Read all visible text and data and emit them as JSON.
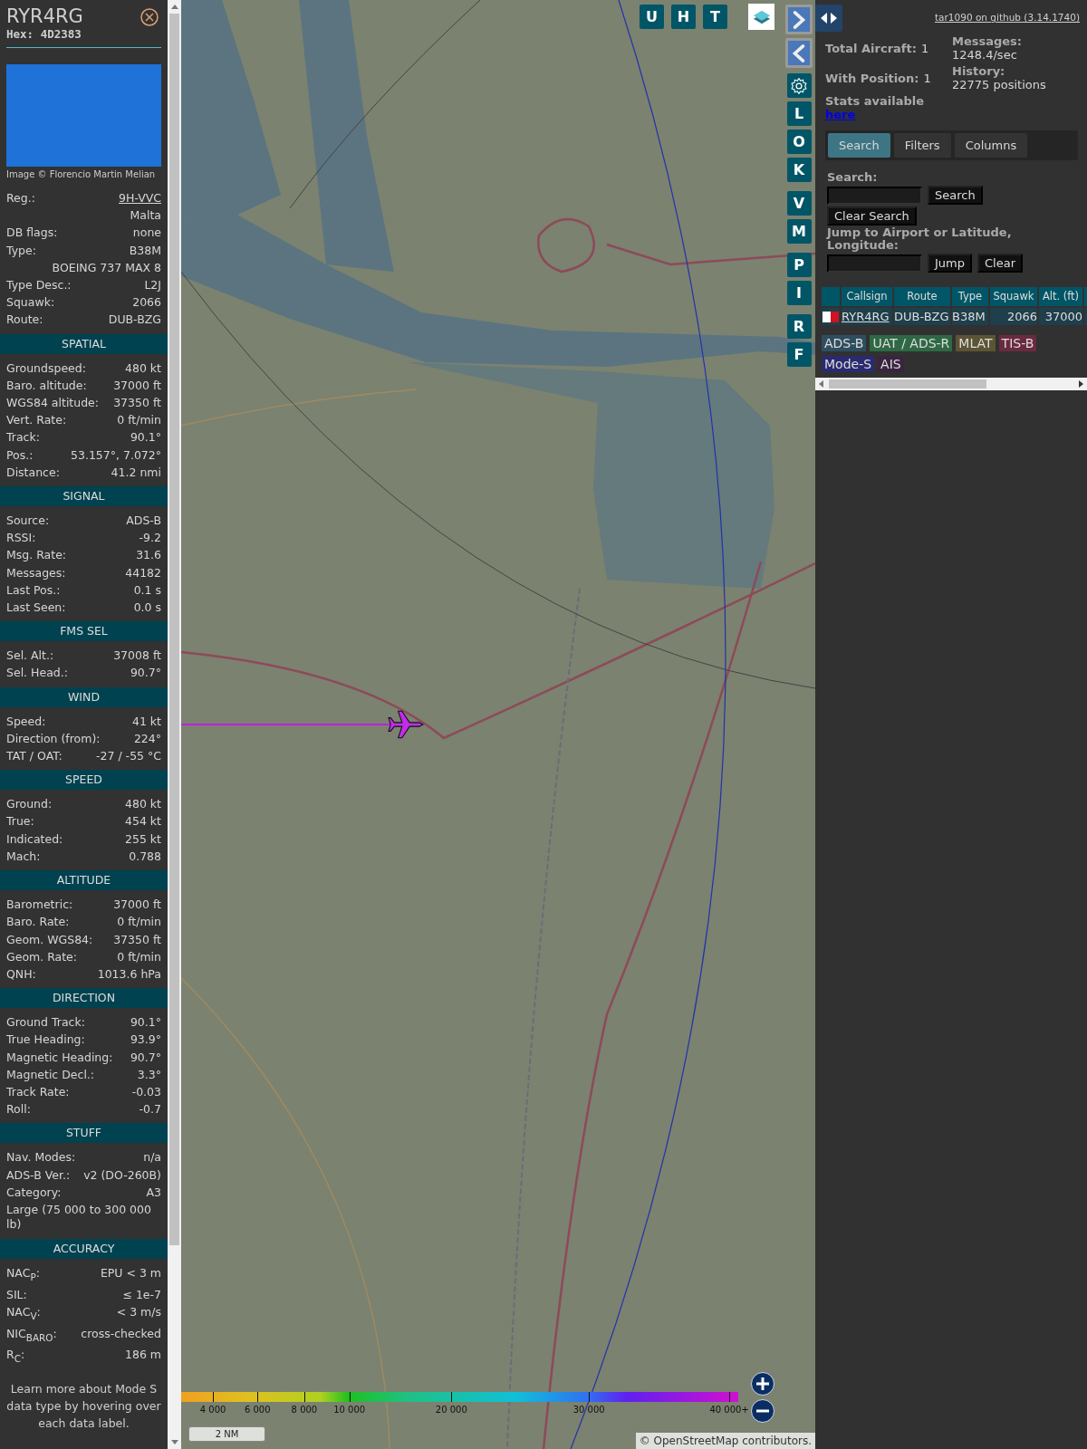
{
  "aircraft": {
    "callsign": "RYR4RG",
    "hex": "Hex: 4D2383",
    "photo_credit": "Image © Florencio Martin Melian",
    "details": [
      {
        "kind": "link",
        "label": "Reg.:",
        "value": "9H-VVC"
      },
      {
        "kind": "value",
        "value": "Malta"
      },
      {
        "kind": "pair",
        "label": "DB flags:",
        "value": "none"
      },
      {
        "kind": "pair",
        "label": "Type:",
        "value": "B38M"
      },
      {
        "kind": "value",
        "value": "BOEING 737 MAX 8"
      },
      {
        "kind": "pair",
        "label": "Type Desc.:",
        "value": "L2J"
      },
      {
        "kind": "pair",
        "label": "Squawk:",
        "value": "2066"
      },
      {
        "kind": "pair",
        "label": "Route:",
        "value": "DUB-BZG"
      }
    ]
  },
  "sections": [
    {
      "title": "SPATIAL",
      "rows": [
        {
          "kind": "pair",
          "label": "Groundspeed:",
          "value": "480 kt"
        },
        {
          "kind": "pair",
          "label": "Baro. altitude:",
          "value": "37000 ft"
        },
        {
          "kind": "pair",
          "label": "WGS84 altitude:",
          "value": "37350 ft"
        },
        {
          "kind": "pair",
          "label": "Vert. Rate:",
          "value": "0 ft/min"
        },
        {
          "kind": "pair",
          "label": "Track:",
          "value": "90.1°"
        },
        {
          "kind": "pair",
          "label": "Pos.:",
          "value": "53.157°, 7.072°"
        },
        {
          "kind": "pair",
          "label": "Distance:",
          "value": "41.2 nmi"
        }
      ]
    },
    {
      "title": "SIGNAL",
      "rows": [
        {
          "kind": "pair",
          "label": "Source:",
          "value": "ADS-B"
        },
        {
          "kind": "pair",
          "label": "RSSI:",
          "value": "-9.2"
        },
        {
          "kind": "pair",
          "label": "Msg. Rate:",
          "value": "31.6"
        },
        {
          "kind": "pair",
          "label": "Messages:",
          "value": "44182"
        },
        {
          "kind": "pair",
          "label": "Last Pos.:",
          "value": "0.1 s"
        },
        {
          "kind": "pair",
          "label": "Last Seen:",
          "value": "0.0 s"
        }
      ]
    },
    {
      "title": "FMS SEL",
      "rows": [
        {
          "kind": "pair",
          "label": "Sel. Alt.:",
          "value": "37008 ft"
        },
        {
          "kind": "pair",
          "label": "Sel. Head.:",
          "value": "90.7°"
        }
      ]
    },
    {
      "title": "WIND",
      "rows": [
        {
          "kind": "pair",
          "label": "Speed:",
          "value": "41 kt"
        },
        {
          "kind": "pair",
          "label": "Direction (from):",
          "value": "224°"
        },
        {
          "kind": "pair",
          "label": "TAT / OAT:",
          "value": "-27 / -55 °C"
        }
      ]
    },
    {
      "title": "SPEED",
      "rows": [
        {
          "kind": "pair",
          "label": "Ground:",
          "value": "480 kt"
        },
        {
          "kind": "pair",
          "label": "True:",
          "value": "454 kt"
        },
        {
          "kind": "pair",
          "label": "Indicated:",
          "value": "255 kt"
        },
        {
          "kind": "pair",
          "label": "Mach:",
          "value": "0.788"
        }
      ]
    },
    {
      "title": "ALTITUDE",
      "rows": [
        {
          "kind": "pair",
          "label": "Barometric:",
          "value": "37000 ft"
        },
        {
          "kind": "pair",
          "label": "Baro. Rate:",
          "value": "0 ft/min"
        },
        {
          "kind": "pair",
          "label": "Geom. WGS84:",
          "value": "37350 ft"
        },
        {
          "kind": "pair",
          "label": "Geom. Rate:",
          "value": "0 ft/min"
        },
        {
          "kind": "pair",
          "label": "QNH:",
          "value": "1013.6 hPa"
        }
      ]
    },
    {
      "title": "DIRECTION",
      "rows": [
        {
          "kind": "pair",
          "label": "Ground Track:",
          "value": "90.1°"
        },
        {
          "kind": "pair",
          "label": "True Heading:",
          "value": "93.9°"
        },
        {
          "kind": "pair",
          "label": "Magnetic Heading:",
          "value": "90.7°"
        },
        {
          "kind": "pair",
          "label": "Magnetic Decl.:",
          "value": "3.3°"
        },
        {
          "kind": "pair",
          "label": "Track Rate:",
          "value": "-0.03"
        },
        {
          "kind": "pair",
          "label": "Roll:",
          "value": "-0.7"
        }
      ]
    },
    {
      "title": "STUFF",
      "rows": [
        {
          "kind": "pair",
          "label": "Nav. Modes:",
          "value": "n/a"
        },
        {
          "kind": "pair",
          "label": "ADS-B Ver.:",
          "value": "v2 (DO-260B)"
        },
        {
          "kind": "pair",
          "label": "Category:",
          "value": "A3"
        },
        {
          "kind": "note",
          "value": "Large (75 000 to 300 000 lb)"
        }
      ]
    },
    {
      "title": "ACCURACY",
      "rows": [
        {
          "kind": "pair",
          "label": "NAC$_{P}$:",
          "value": "EPU < 3 m"
        },
        {
          "kind": "pair",
          "label": "SIL:",
          "value": "≤ 1e-7"
        },
        {
          "kind": "pair",
          "label": "NAC$_{V}$:",
          "value": "< 3 m/s"
        },
        {
          "kind": "pair",
          "label": "NIC$_{BARO}$:",
          "value": "cross-checked"
        },
        {
          "kind": "pair",
          "label": "R$_{C}$:",
          "value": "186 m"
        }
      ]
    }
  ],
  "footer_note": "Learn more about Mode S data type by hovering over each data label.",
  "map": {
    "top_buttons": [
      "U",
      "H",
      "T"
    ],
    "side_button_groups": [
      [
        "L",
        "O",
        "K"
      ],
      [
        "V",
        "M"
      ],
      [
        "P",
        "I"
      ],
      [
        "R",
        "F"
      ]
    ],
    "legend_labels": [
      "4 000",
      "6 000",
      "8 000",
      "10 000",
      "20 000",
      "30 000",
      "40 000+"
    ],
    "scale": "2 NM",
    "attribution": {
      "prefix": "©",
      "link": "OpenStreetMap",
      "suffix": "contributors."
    }
  },
  "header_link": "tar1090 on github (3.14.1740)",
  "stats_columns": [
    [
      {
        "label": "Total Aircraft:",
        "value": "1"
      },
      {
        "label": "With Position:",
        "value": "1"
      }
    ],
    [
      {
        "label": "Messages:",
        "value": "1248.4/sec"
      },
      {
        "label": "History:",
        "value": "22775 positions"
      }
    ]
  ],
  "stats_link": {
    "text": "Stats available",
    "link": "here"
  },
  "tabs": [
    {
      "label": "Search",
      "selected": true
    },
    {
      "label": "Filters",
      "selected": false
    },
    {
      "label": "Columns",
      "selected": false
    }
  ],
  "search": {
    "label": "Search:",
    "button": "Search",
    "clear_button": "Clear Search",
    "jump_label": "Jump to Airport or Latitude, Longitude:",
    "jump_button": "Jump",
    "jump_clear_button": "Clear"
  },
  "table": {
    "columns": [
      "Callsign",
      "Route",
      "Type",
      "Squawk",
      "Alt. (ft)"
    ],
    "rows": [
      {
        "cells": [
          "RYR4RG",
          "DUB-BZG",
          "B38M",
          "2066",
          "37000"
        ]
      }
    ]
  },
  "source_tags": [
    {
      "label": "ADS-B",
      "color": "#2e4e60"
    },
    {
      "label": "UAT / ADS-R",
      "color": "#2e6844"
    },
    {
      "label": "MLAT",
      "color": "#5c5434"
    },
    {
      "label": "TIS-B",
      "color": "#6a2a40"
    },
    {
      "label": "Mode-S",
      "color": "#2a2a70"
    },
    {
      "label": "AIS",
      "color": "#3a2440"
    }
  ]
}
